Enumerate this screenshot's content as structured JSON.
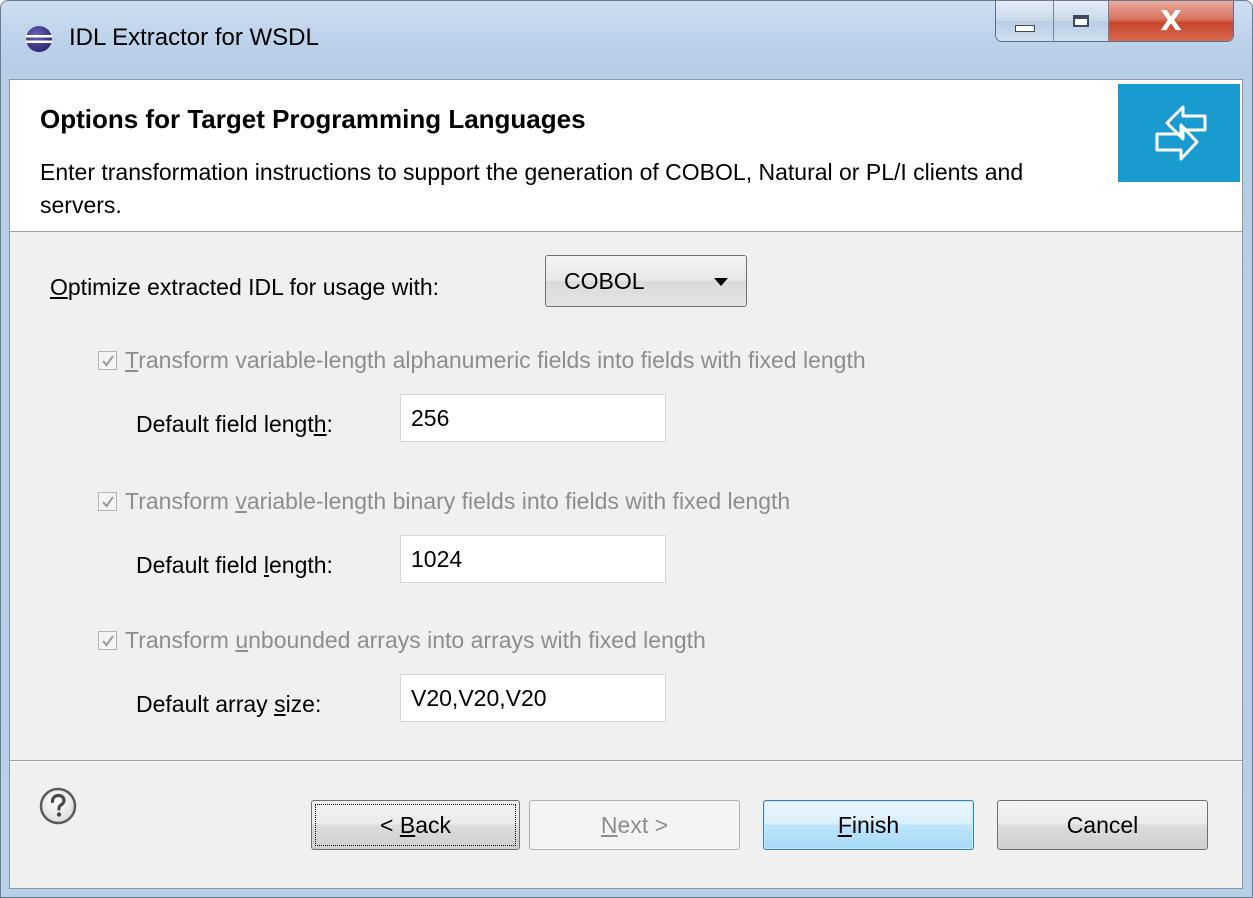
{
  "window": {
    "title": "IDL Extractor for WSDL",
    "close_glyph": "X"
  },
  "header": {
    "title": "Options for Target Programming Languages",
    "description": "Enter transformation instructions to support the generation of COBOL, Natural or PL/I clients and servers."
  },
  "optimize": {
    "label_mnemonic": "O",
    "label_rest": "ptimize extracted IDL for usage with:",
    "selected": "COBOL"
  },
  "options": [
    {
      "checked": true,
      "check_pre": "",
      "check_mn": "T",
      "check_post": "ransform variable-length alphanumeric fields into fields with fixed length",
      "field_pre": "Default field lengt",
      "field_mn": "h",
      "field_post": ":",
      "value": "256"
    },
    {
      "checked": true,
      "check_pre": "Transform ",
      "check_mn": "v",
      "check_post": "ariable-length binary fields into fields with fixed length",
      "field_pre": "Default field ",
      "field_mn": "l",
      "field_post": "ength:",
      "value": "1024"
    },
    {
      "checked": true,
      "check_pre": "Transform ",
      "check_mn": "u",
      "check_post": "nbounded arrays into arrays with fixed length",
      "field_pre": "Default array ",
      "field_mn": "s",
      "field_post": "ize:",
      "value": "V20,V20,V20"
    }
  ],
  "buttons": {
    "back_pre": "< ",
    "back_mn": "B",
    "back_post": "ack",
    "next_mn": "N",
    "next_post": "ext >",
    "finish_mn": "F",
    "finish_post": "inish",
    "cancel": "Cancel"
  },
  "icons": {
    "app": "eclipse-icon",
    "help": "help-icon",
    "banner": "transform-arrows-icon"
  },
  "colors": {
    "banner": "#1a9bd0",
    "disabled_text": "#8d8d8d",
    "default_button_border": "#3c7fb1"
  }
}
